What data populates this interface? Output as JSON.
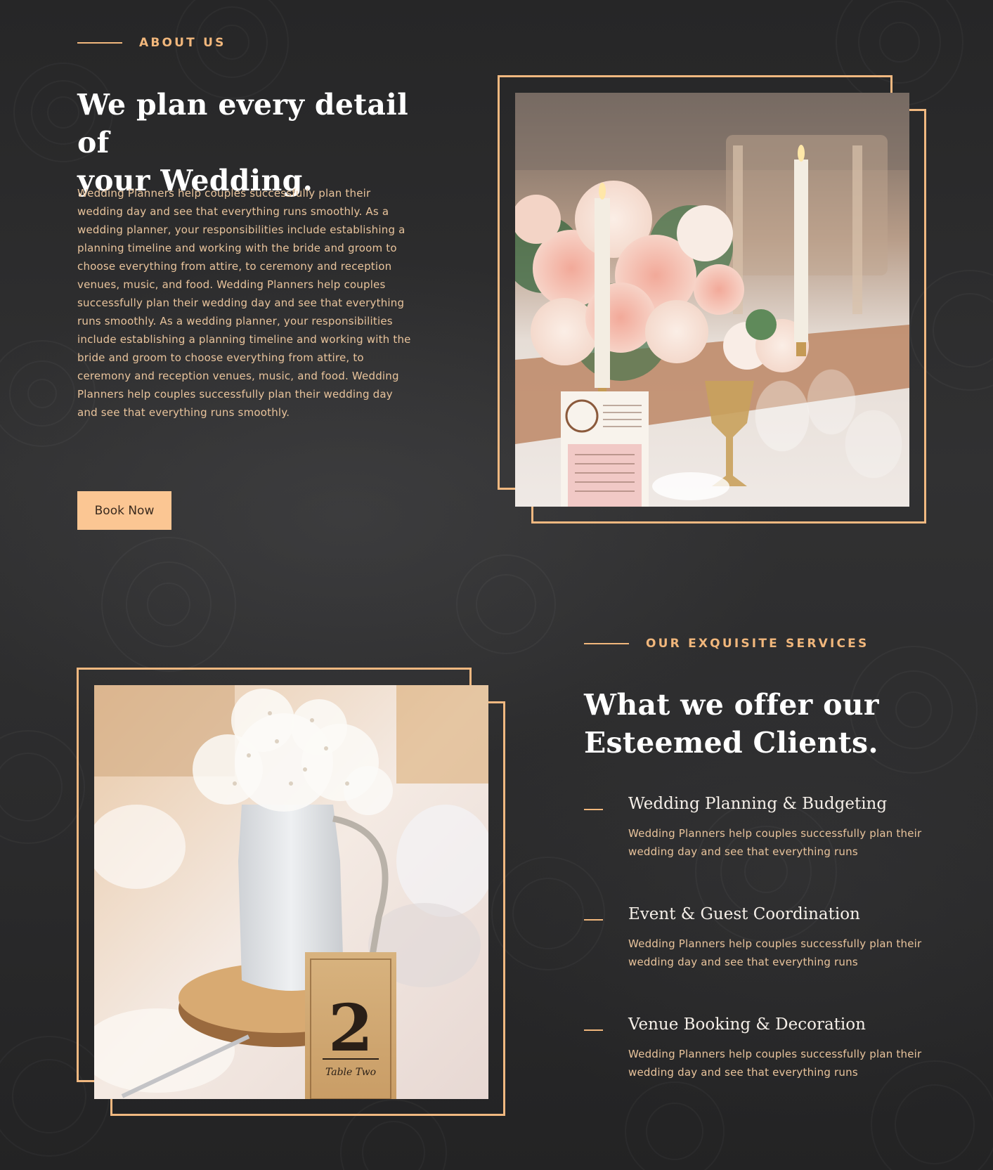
{
  "about": {
    "eyebrow": "ABOUT US",
    "heading_line1": "We plan every detail of",
    "heading_line2": "your Wedding.",
    "body": "Wedding Planners help couples successfully plan their wedding day and see that everything runs smoothly. As a wedding planner, your responsibilities include establishing a planning timeline and working with the bride and groom to choose everything from attire, to ceremony and reception venues, music, and food.  Wedding Planners help couples successfully plan their wedding day and see that everything runs smoothly. As a wedding planner, your responsibilities include establishing a planning timeline and working with the bride and groom to choose everything from attire, to ceremony and reception venues, music, and food. Wedding Planners help couples successfully plan their wedding day and see that everything runs smoothly.",
    "button_label": "Book Now",
    "photo_icon": "table-centerpiece-with-candles-photo"
  },
  "services": {
    "eyebrow": "OUR EXQUISITE SERVICES",
    "heading_line1": "What we offer our",
    "heading_line2": "Esteemed Clients.",
    "photo_icon": "flower-vase-table-number-photo",
    "photo_table_number": "2",
    "photo_table_caption": "Table Two",
    "items": [
      {
        "title": "Wedding Planning & Budgeting",
        "description": "Wedding Planners help couples successfully plan their wedding day and see that everything runs"
      },
      {
        "title": "Event & Guest Coordination",
        "description": "Wedding Planners help couples successfully plan their wedding day and see that everything runs"
      },
      {
        "title": "Venue Booking & Decoration",
        "description": "Wedding Planners help couples successfully plan their wedding day and see that everything runs"
      }
    ]
  },
  "colors": {
    "accent": "#f1b77c",
    "button_bg": "#fbc693",
    "body_text": "#e9c49c",
    "background": "#2c2c2d"
  }
}
